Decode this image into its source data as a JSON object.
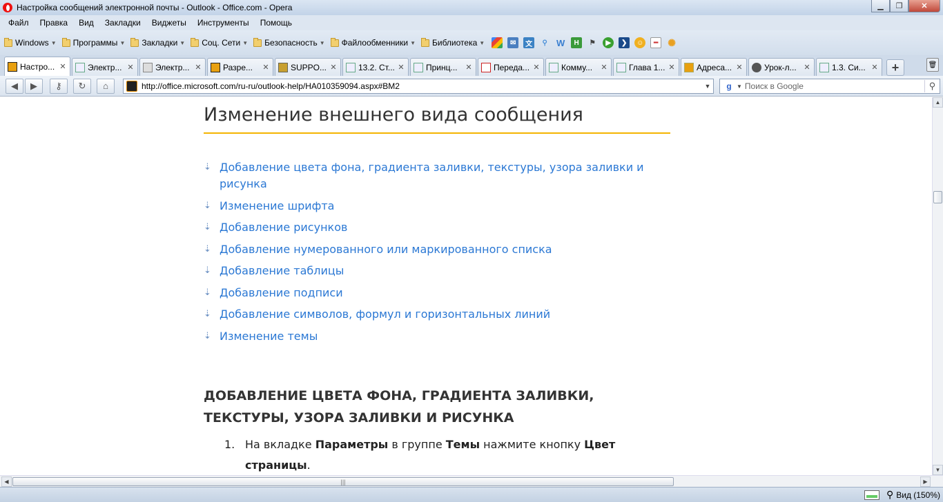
{
  "window": {
    "title": "Настройка сообщений электронной почты - Outlook - Office.com - Opera"
  },
  "menu": [
    "Файл",
    "Правка",
    "Вид",
    "Закладки",
    "Виджеты",
    "Инструменты",
    "Помощь"
  ],
  "bookmarks": {
    "folders": [
      "Windows",
      "Программы",
      "Закладки",
      "Соц. Сети",
      "Безопасность",
      "Файлообменники",
      "Библиотека"
    ],
    "icons": [
      "google-icon",
      "mail-icon",
      "translate-icon",
      "antenna-icon",
      "w-icon",
      "h-icon",
      "flag-icon",
      "play-icon",
      "arrow-icon",
      "bulb-icon",
      "cigarette-icon",
      "sun-icon"
    ]
  },
  "tabs": [
    {
      "label": "Настро...",
      "active": true,
      "icon": "#e8a010"
    },
    {
      "label": "Электр...",
      "active": false,
      "icon": "#3a8a3a"
    },
    {
      "label": "Электр...",
      "active": false,
      "icon": "#888888"
    },
    {
      "label": "Разре...",
      "active": false,
      "icon": "#e8a010"
    },
    {
      "label": "SUPPO...",
      "active": false,
      "icon": "#c8a030"
    },
    {
      "label": "13.2. Ст...",
      "active": false,
      "icon": "#3a8a3a"
    },
    {
      "label": "Принц...",
      "active": false,
      "icon": "#3a8a3a"
    },
    {
      "label": "Переда...",
      "active": false,
      "icon": "#cc2222"
    },
    {
      "label": "Комму...",
      "active": false,
      "icon": "#3a8a3a"
    },
    {
      "label": "Глава 1...",
      "active": false,
      "icon": "#3a8a3a"
    },
    {
      "label": "Адреса...",
      "active": false,
      "icon": "#e8a010"
    },
    {
      "label": "Урок-л...",
      "active": false,
      "icon": "#555555"
    },
    {
      "label": "1.3. Си...",
      "active": false,
      "icon": "#3a8a3a"
    }
  ],
  "address": {
    "url": "http://office.microsoft.com/ru-ru/outlook-help/HA010359094.aspx#BM2",
    "search_placeholder": "Поиск в Google"
  },
  "page": {
    "heading": "Изменение внешнего вида сообщения",
    "toc": [
      "Добавление цвета фона, градиента заливки, текстуры, узора заливки и рисунка",
      "Изменение шрифта",
      "Добавление рисунков",
      "Добавление нумерованного или маркированного списка",
      "Добавление таблицы",
      "Добавление подписи",
      "Добавление символов, формул и горизонтальных линий",
      "Изменение темы"
    ],
    "section_heading": "ДОБАВЛЕНИЕ ЦВЕТА ФОНА, ГРАДИЕНТА ЗАЛИВКИ, ТЕКСТУРЫ, УЗОРА ЗАЛИВКИ И РИСУНКА",
    "step1": {
      "num": "1.",
      "t1": "На вкладке ",
      "b1": "Параметры",
      "t2": " в группе ",
      "b2": "Темы",
      "t3": " нажмите кнопку ",
      "b3": "Цвет страницы",
      "t4": "."
    }
  },
  "status": {
    "zoom_label": "Вид (150%)"
  },
  "colors": {
    "link": "#2b78d4",
    "heading_rule": "#f4b400"
  }
}
